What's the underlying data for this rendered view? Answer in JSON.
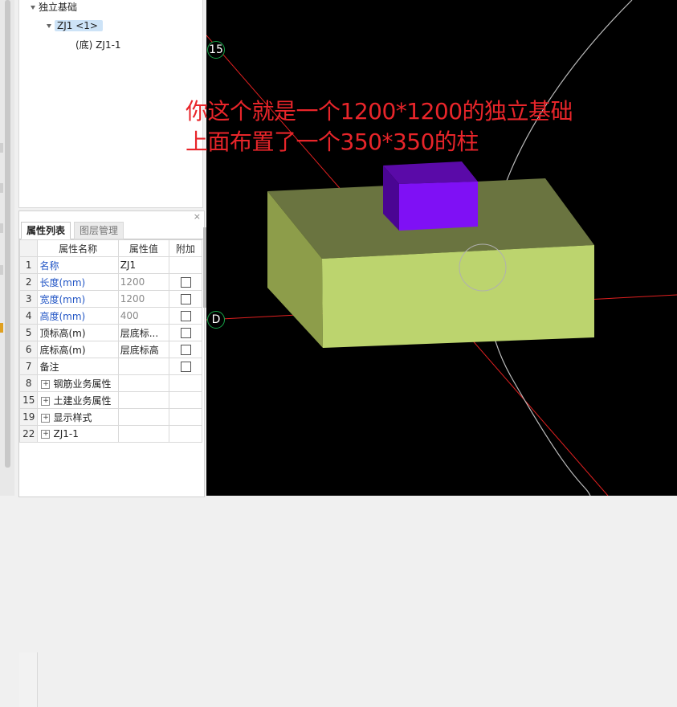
{
  "tree": {
    "root_label": "独立基础",
    "child_label": "ZJ1 <1>",
    "leaf_label": "(底) ZJ1-1"
  },
  "props": {
    "close_symbol": "×",
    "tabs": [
      "属性列表",
      "图层管理"
    ],
    "headers": [
      "属性名称",
      "属性值",
      "附加"
    ],
    "rows": [
      {
        "num": "1",
        "name": "名称",
        "value": "ZJ1"
      },
      {
        "num": "2",
        "name": "长度(mm)",
        "value": "1200"
      },
      {
        "num": "3",
        "name": "宽度(mm)",
        "value": "1200"
      },
      {
        "num": "4",
        "name": "高度(mm)",
        "value": "400"
      },
      {
        "num": "5",
        "name": "顶标高(m)",
        "value": "层底标..."
      },
      {
        "num": "6",
        "name": "底标高(m)",
        "value": "层底标高"
      },
      {
        "num": "7",
        "name": "备注",
        "value": ""
      },
      {
        "num": "8",
        "name": "钢筋业务属性",
        "value": ""
      },
      {
        "num": "15",
        "name": "土建业务属性",
        "value": ""
      },
      {
        "num": "19",
        "name": "显示样式",
        "value": ""
      },
      {
        "num": "22",
        "name": "ZJ1-1",
        "value": ""
      }
    ]
  },
  "viewport": {
    "axis_labels": [
      "15",
      "D"
    ],
    "annotation_line1": "你这个就是一个1200*1200的独立基础",
    "annotation_line2": "上面布置了一个350*350的柱"
  },
  "colors": {
    "annotation": "#e8252a",
    "footing_front": "#bcd46e",
    "footing_top": "#6a7440",
    "column_front": "#7f10f5",
    "column_side": "#4a0593",
    "grid_line": "#e02020",
    "axis_circle": "#18a84a"
  }
}
